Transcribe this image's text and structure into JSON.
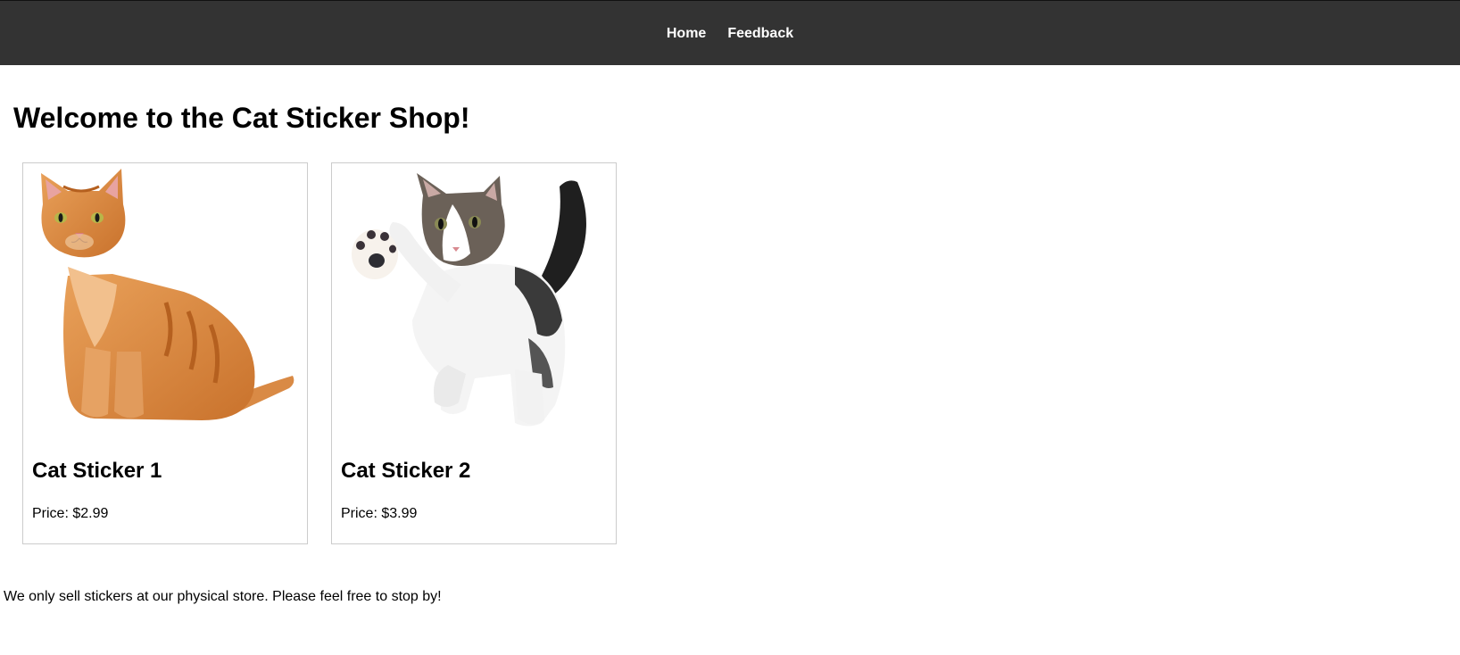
{
  "nav": {
    "items": [
      {
        "label": "Home"
      },
      {
        "label": "Feedback"
      }
    ]
  },
  "page": {
    "title": "Welcome to the Cat Sticker Shop!",
    "footer_note": "We only sell stickers at our physical store. Please feel free to stop by!"
  },
  "products": [
    {
      "name": "Cat Sticker 1",
      "price": "Price: $2.99",
      "image": "orange-tabby-cat-sitting"
    },
    {
      "name": "Cat Sticker 2",
      "price": "Price: $3.99",
      "image": "kitten-raising-paw"
    }
  ],
  "colors": {
    "nav_bg": "#333333",
    "nav_text": "#ffffff",
    "card_border": "#cccccc"
  }
}
